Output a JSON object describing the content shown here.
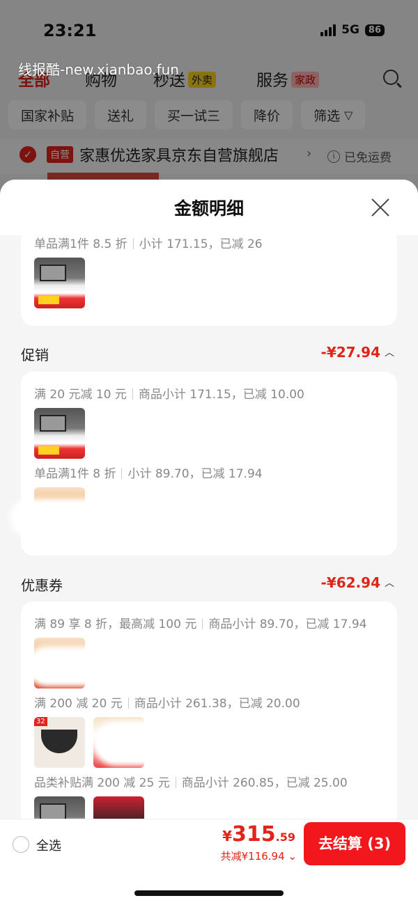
{
  "status_bar": {
    "time": "23:21",
    "network": "5G",
    "battery": "86"
  },
  "watermark": "线报酷-new.xianbao.fun",
  "category_tabs": [
    {
      "label": "全部",
      "active": true
    },
    {
      "label": "购物",
      "active": false
    },
    {
      "label": "秒送",
      "badge": "外卖",
      "active": false
    },
    {
      "label": "服务",
      "badge": "家政",
      "active": false
    }
  ],
  "filter_chips": [
    "国家补贴",
    "送礼",
    "买一试三",
    "降价",
    "筛选"
  ],
  "store": {
    "tag": "自营",
    "name": "家惠优选家具京东自营旗舰店",
    "shipping": "已免运费"
  },
  "sheet": {
    "title": "金额明细",
    "top_card": {
      "rule": "单品满1件 8.5 折",
      "detail": "小计 171.15，已减 26"
    },
    "sections": [
      {
        "title": "促销",
        "amount": "-¥27.94",
        "rules": [
          {
            "rule": "满 20 元减 10 元",
            "detail": "商品小计 171.15，已减 10.00"
          },
          {
            "rule": "单品满1件 8 折",
            "detail": "小计 89.70，已减 17.94"
          }
        ]
      },
      {
        "title": "优惠券",
        "amount": "-¥62.94",
        "rules": [
          {
            "rule": "满 89 享 8 折，最高减 100 元",
            "detail": "商品小计 89.70，已减 17.94"
          },
          {
            "rule": "满 200 减 20 元",
            "detail": "商品小计 261.38，已减 20.00"
          },
          {
            "rule": "品类补贴满 200 减 25 元",
            "detail": "商品小计 260.85，已减 25.00"
          }
        ]
      }
    ]
  },
  "bottom_bar": {
    "select_all": "全选",
    "total_currency": "¥",
    "total_int": "315",
    "total_dec": ".59",
    "saved": "共减¥116.94",
    "checkout": "去结算 (3)"
  },
  "colors": {
    "accent": "#e2231a",
    "checkout": "#f2171d"
  }
}
